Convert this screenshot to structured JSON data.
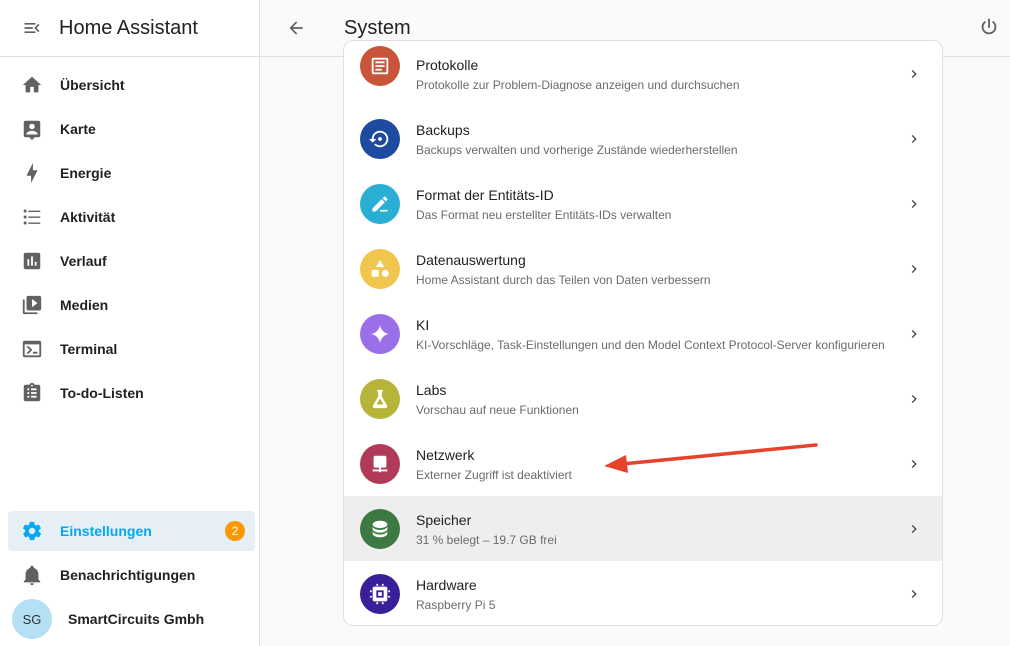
{
  "sidebar": {
    "title": "Home Assistant",
    "items": [
      {
        "label": "Übersicht",
        "icon": "home-icon"
      },
      {
        "label": "Karte",
        "icon": "map-account-icon"
      },
      {
        "label": "Energie",
        "icon": "lightning-icon"
      },
      {
        "label": "Aktivität",
        "icon": "list-icon"
      },
      {
        "label": "Verlauf",
        "icon": "chart-box-icon"
      },
      {
        "label": "Medien",
        "icon": "play-box-multiple-icon"
      },
      {
        "label": "Terminal",
        "icon": "console-icon"
      },
      {
        "label": "To-do-Listen",
        "icon": "clipboard-list-icon"
      }
    ],
    "settings_label": "Einstellungen",
    "settings_badge": "2",
    "notifications_label": "Benachrichtigungen",
    "user_initials": "SG",
    "user_name": "SmartCircuits Gmbh"
  },
  "header": {
    "title": "System"
  },
  "rows": [
    {
      "title": "Protokolle",
      "subtitle": "Protokolle zur Problem-Diagnose anzeigen und durchsuchen",
      "color": "#c8553a"
    },
    {
      "title": "Backups",
      "subtitle": "Backups verwalten und vorherige Zustände wiederherstellen",
      "color": "#1e4aa0"
    },
    {
      "title": "Format der Entitäts-ID",
      "subtitle": "Das Format neu erstellter Entitäts-IDs verwalten",
      "color": "#2aaed4"
    },
    {
      "title": "Datenauswertung",
      "subtitle": "Home Assistant durch das Teilen von Daten verbessern",
      "color": "#f0c64f"
    },
    {
      "title": "KI",
      "subtitle": "KI-Vorschläge, Task-Einstellungen und den Model Context Protocol-Server konfigurieren",
      "color": "#9a6fe8"
    },
    {
      "title": "Labs",
      "subtitle": "Vorschau auf neue Funktionen",
      "color": "#b7b43a"
    },
    {
      "title": "Netzwerk",
      "subtitle": "Externer Zugriff ist deaktiviert",
      "color": "#b03a58"
    },
    {
      "title": "Speicher",
      "subtitle": "31 % belegt – 19.7 GB frei",
      "color": "#3d7a43"
    },
    {
      "title": "Hardware",
      "subtitle": "Raspberry Pi 5",
      "color": "#3a1f9a"
    }
  ],
  "annotation": {
    "color": "#e8432a"
  }
}
